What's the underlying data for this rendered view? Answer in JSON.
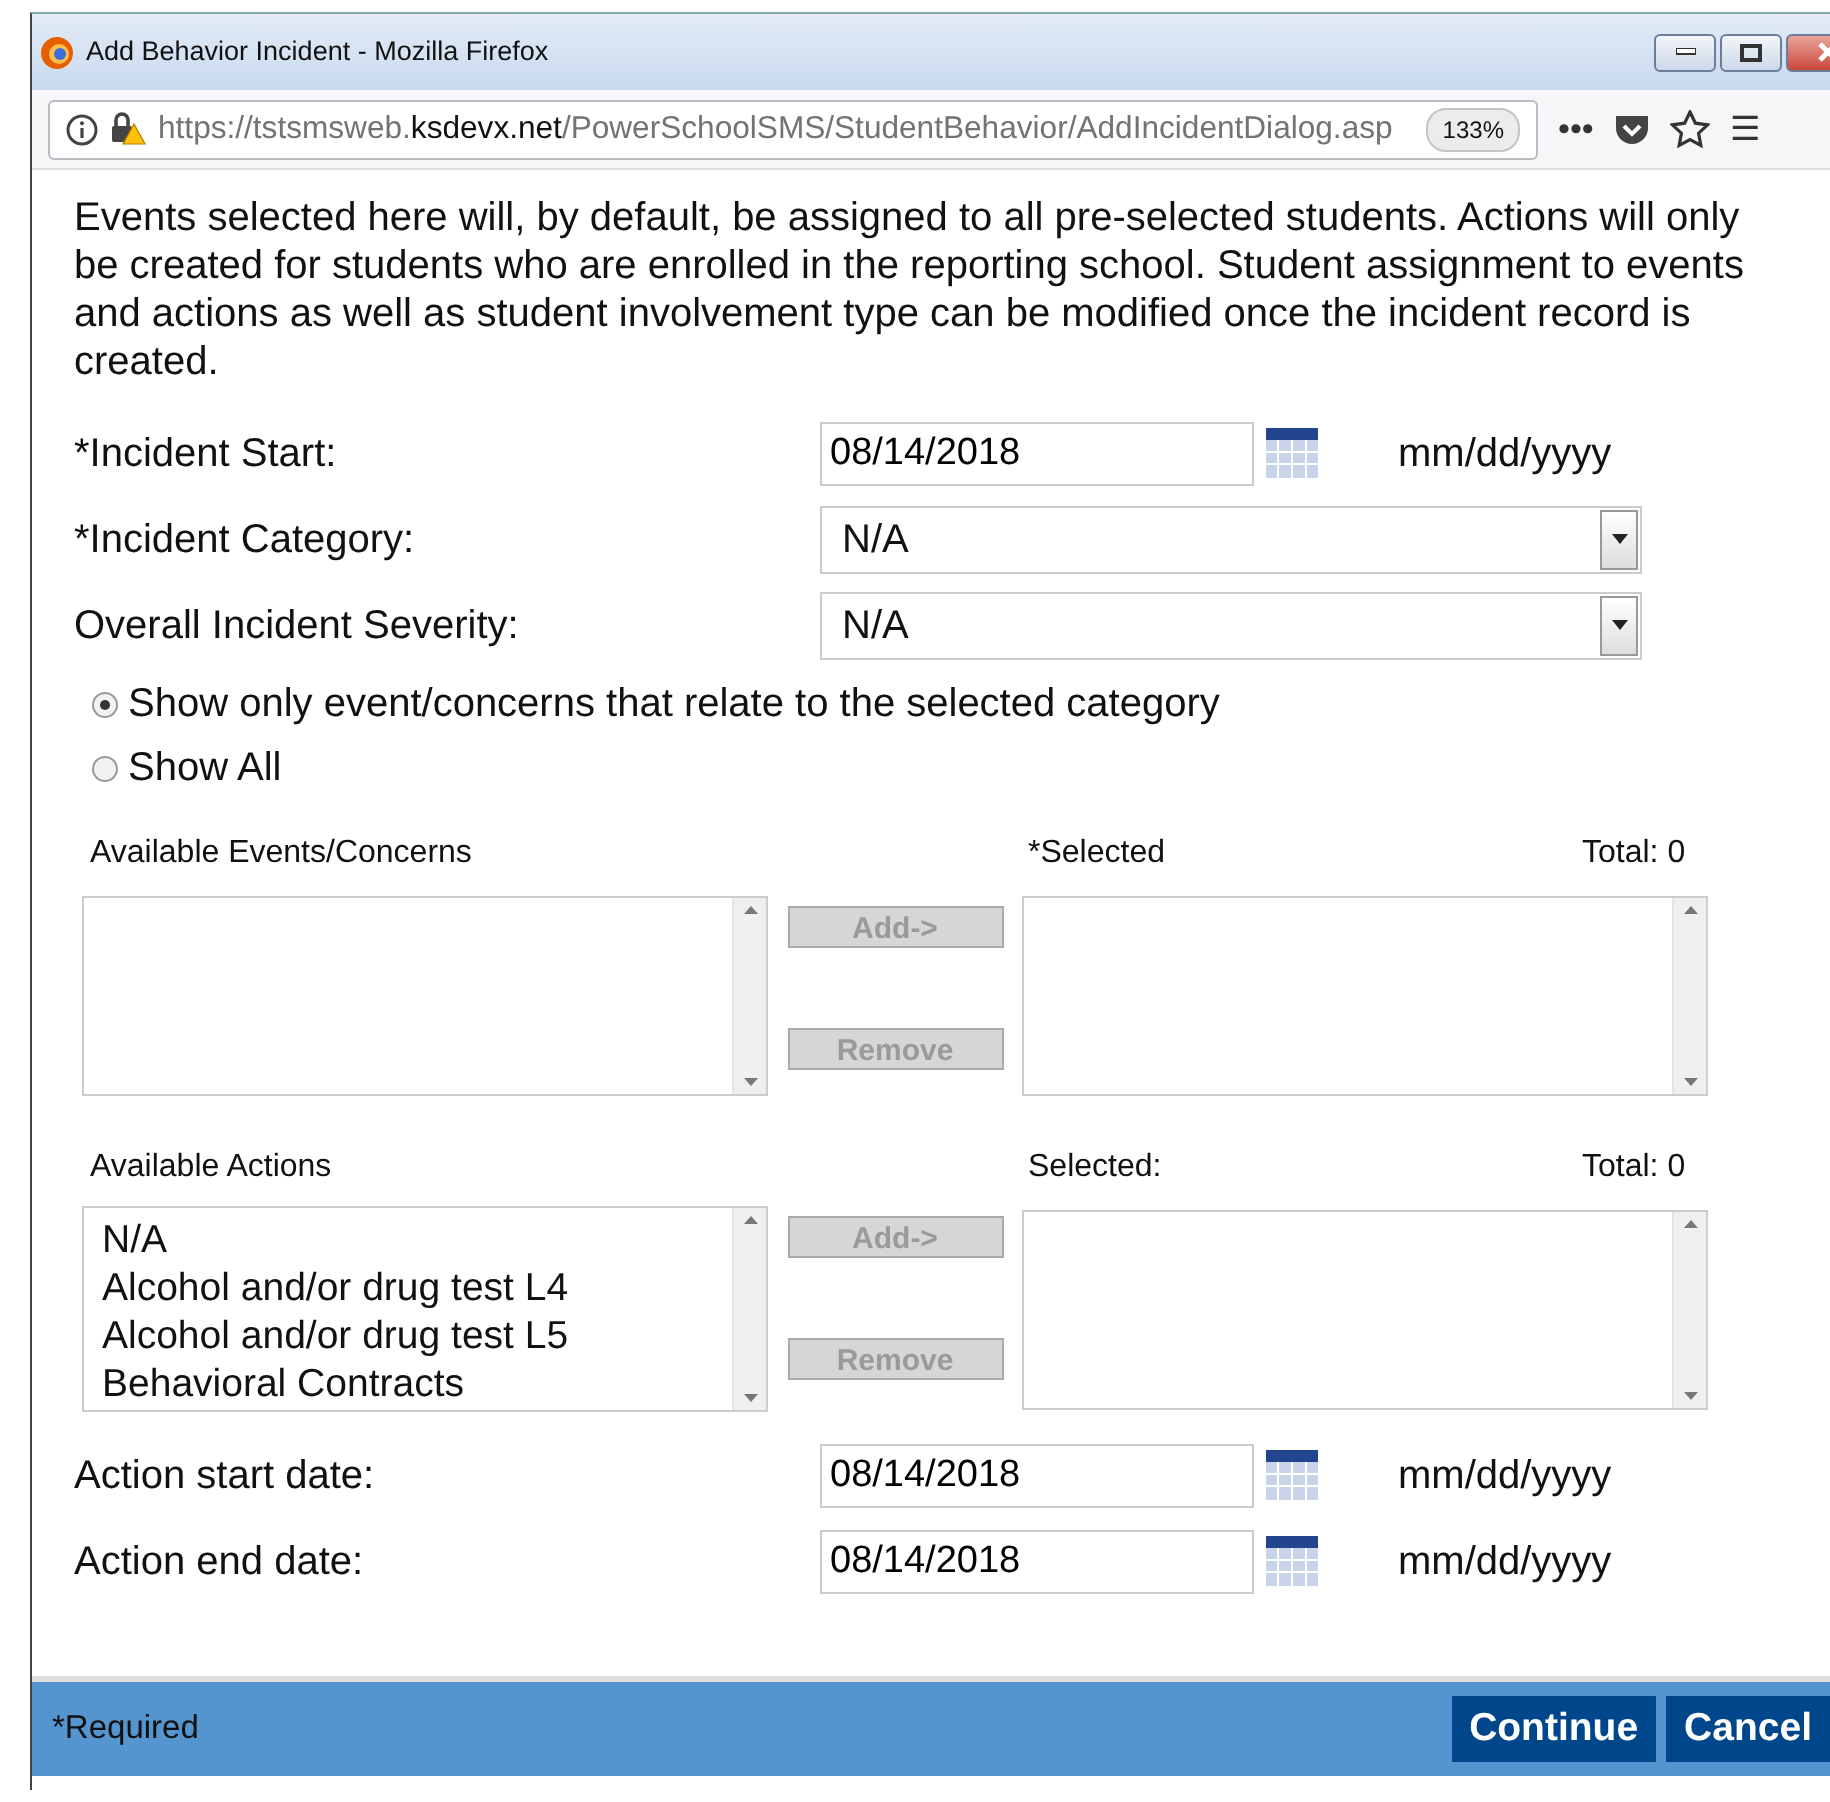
{
  "window": {
    "title": "Add Behavior Incident - Mozilla Firefox"
  },
  "address_bar": {
    "url_start": "https://tstsmsweb.",
    "url_domain": "ksdevx.net",
    "url_path": "/PowerSchoolSMS/StudentBehavior/AddIncidentDialog.asp",
    "zoom": "133%"
  },
  "toolbar": {
    "more": "•••",
    "menu": "☰"
  },
  "intro": "Events selected here will, by default, be assigned to all pre-selected students. Actions will only be created for students who are enrolled in the reporting school. Student assignment to events and actions as well as student involvement type can be modified once the incident record is created.",
  "fields": [
    {
      "kind": "date",
      "label": "*Incident Start:",
      "value": "08/14/2018",
      "hint": "mm/dd/yyyy"
    },
    {
      "kind": "select",
      "label": "*Incident Category:",
      "value": "N/A"
    },
    {
      "kind": "select",
      "label": "Overall Incident Severity:",
      "value": "N/A"
    }
  ],
  "filter_options": [
    {
      "label": "Show only event/concerns that relate to the selected category",
      "selected": true
    },
    {
      "label": "Show All",
      "selected": false
    }
  ],
  "pickers": [
    {
      "available_label": "Available Events/Concerns",
      "selected_label": "*Selected",
      "total": "Total:  0",
      "buttons": [
        {
          "label": "Add->",
          "disabled": true
        },
        {
          "label": "Remove",
          "disabled": true
        }
      ]
    },
    {
      "available_label": "Available Actions",
      "selected_label": "Selected:",
      "total": "Total:  0",
      "available_items": [
        "N/A",
        "Alcohol and/or drug test L4",
        "Alcohol and/or drug test L5",
        "Behavioral Contracts"
      ],
      "buttons": [
        {
          "label": "Add->",
          "disabled": true
        },
        {
          "label": "Remove",
          "disabled": true
        }
      ]
    }
  ],
  "action_dates": [
    {
      "kind": "date",
      "label": "Action start date:",
      "value": "08/14/2018",
      "hint": "mm/dd/yyyy"
    },
    {
      "kind": "date",
      "label": "Action end date:",
      "value": "08/14/2018",
      "hint": "mm/dd/yyyy"
    }
  ],
  "footer": {
    "note": "*Required",
    "buttons": [
      "Continue",
      "Cancel"
    ]
  }
}
